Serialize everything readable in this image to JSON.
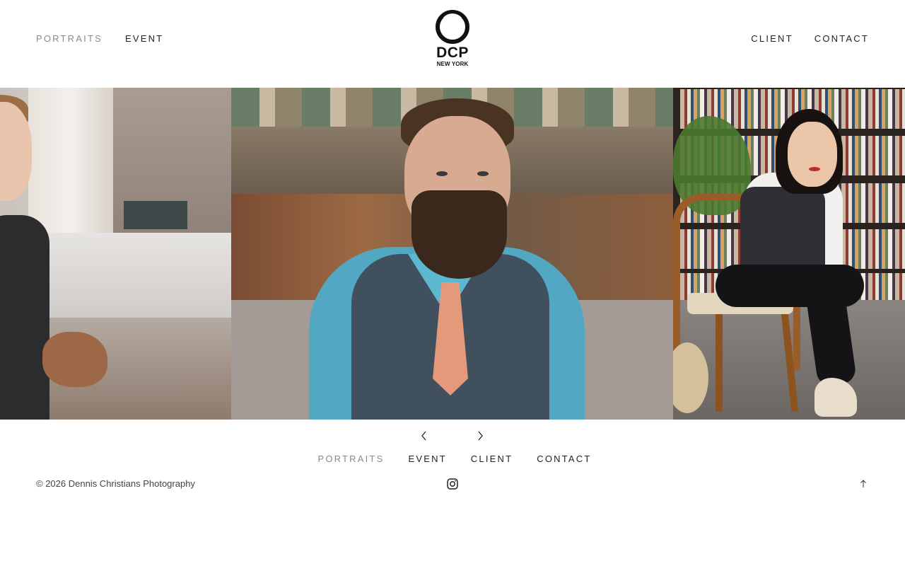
{
  "header": {
    "nav_left": [
      {
        "label": "PORTRAITS",
        "active": true
      },
      {
        "label": "EVENT",
        "active": false
      }
    ],
    "nav_right": [
      {
        "label": "CLIENT"
      },
      {
        "label": "CONTACT"
      }
    ],
    "logo": {
      "text": "DCP",
      "subtext": "NEW YORK"
    }
  },
  "carousel": {
    "slides": [
      {
        "description": "portrait-left-partial"
      },
      {
        "description": "portrait-center"
      },
      {
        "description": "portrait-right"
      }
    ],
    "prev_icon": "chevron-left-icon",
    "next_icon": "chevron-right-icon"
  },
  "footer": {
    "nav": [
      {
        "label": "PORTRAITS",
        "active": true
      },
      {
        "label": "EVENT"
      },
      {
        "label": "CLIENT"
      },
      {
        "label": "CONTACT"
      }
    ],
    "copyright": "© 2026 Dennis Christians Photography",
    "social_icon": "instagram-icon",
    "back_to_top_icon": "arrow-up-icon"
  },
  "colors": {
    "active_nav": "#8a8a8a",
    "text": "#222222",
    "background": "#ffffff"
  }
}
